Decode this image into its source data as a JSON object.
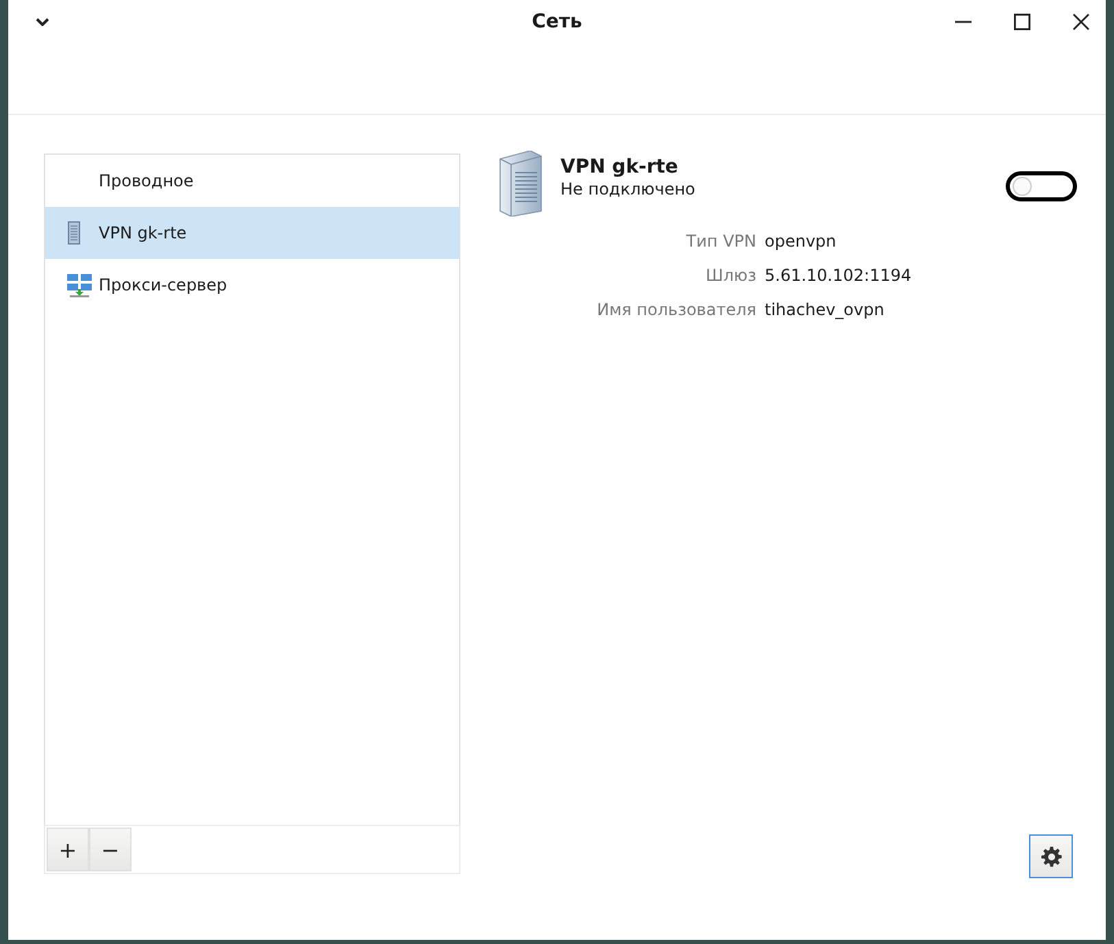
{
  "window": {
    "title": "Сеть"
  },
  "connections": [
    {
      "label": "Проводное",
      "kind": "wired",
      "selected": false
    },
    {
      "label": "VPN gk-rte",
      "kind": "vpn",
      "selected": true
    },
    {
      "label": "Прокси-сервер",
      "kind": "proxy",
      "selected": false
    }
  ],
  "list_buttons": [
    "+",
    "−"
  ],
  "detail": {
    "name": "VPN gk-rte",
    "status": "Не подключено",
    "connected": false,
    "properties": [
      {
        "label": "Тип VPN",
        "value": "openvpn"
      },
      {
        "label": "Шлюз",
        "value": "5.61.10.102:1194"
      },
      {
        "label": "Имя пользователя",
        "value": "tihachev_ovpn"
      }
    ]
  }
}
